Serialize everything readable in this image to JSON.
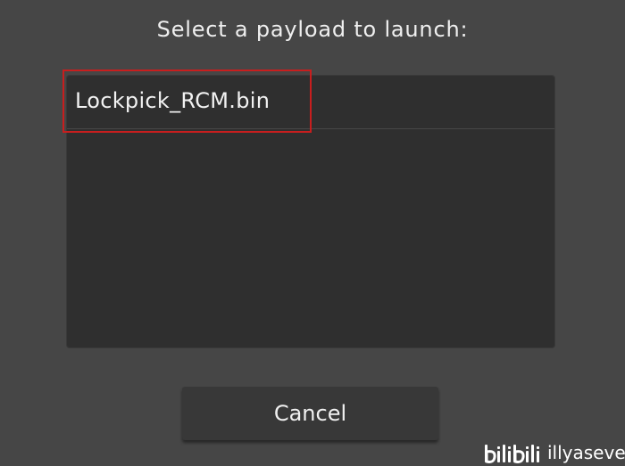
{
  "dialog": {
    "title": "Select a payload to launch:"
  },
  "payload_list": {
    "items": [
      {
        "label": "Lockpick_RCM.bin"
      }
    ]
  },
  "actions": {
    "cancel_label": "Cancel"
  },
  "watermark": {
    "logo": "bilibili",
    "username": "illyasever"
  },
  "colors": {
    "background": "#464646",
    "panel": "#2f2f2f",
    "button": "#383838",
    "highlight": "#c81e1e",
    "text": "#efefef"
  }
}
